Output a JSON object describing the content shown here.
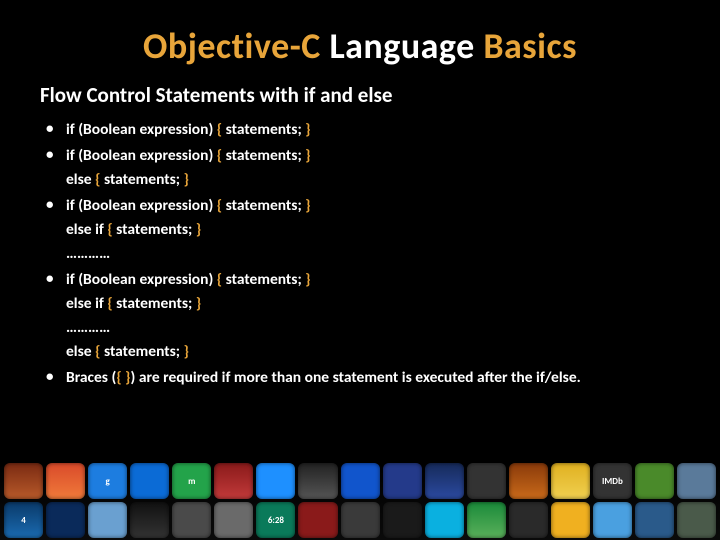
{
  "title": {
    "part1": "Objective-C",
    "part2": "Language",
    "part3": "Basics"
  },
  "subtitle": "Flow Control Statements with if and else",
  "bullets": [
    {
      "lines": [
        "if (Boolean expression) { statements; }"
      ]
    },
    {
      "lines": [
        "if (Boolean expression) { statements; }",
        "else { statements; }"
      ]
    },
    {
      "lines": [
        "if (Boolean expression) { statements; }",
        "else if { statements; }",
        "…………"
      ]
    },
    {
      "lines": [
        "if (Boolean expression) { statements; }",
        "else if { statements; }",
        "…………",
        "else { statements; }"
      ]
    },
    {
      "lines": [
        "Braces ({ }) are required if more than one statement is executed after the if/else."
      ]
    }
  ],
  "dock_rows": [
    [
      "",
      "",
      "g",
      "",
      "m",
      "",
      "",
      "",
      "",
      "",
      "",
      "",
      "",
      "",
      "IMDb",
      "",
      ""
    ],
    [
      "4",
      "",
      "",
      "",
      "",
      "",
      "6:28",
      "",
      "",
      "",
      "",
      "",
      "",
      "",
      "",
      "",
      ""
    ]
  ]
}
